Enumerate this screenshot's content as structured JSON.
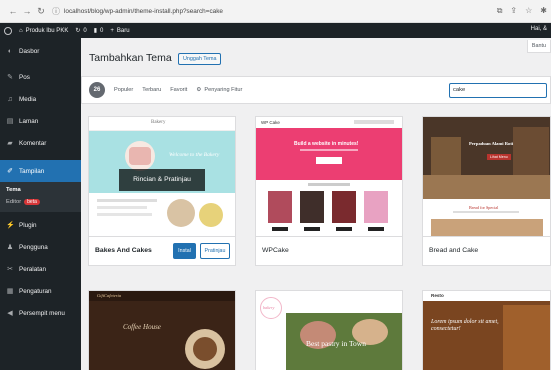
{
  "browser": {
    "back_icon": "arrow-left-icon",
    "forward_icon": "arrow-right-icon",
    "reload_icon": "reload-icon",
    "url": "localhost/blog/wp-admin/theme-install.php?search=cake"
  },
  "admin_bar": {
    "site_name": "Produk Ibu PKK",
    "comments_count": "0",
    "updates_count": "0",
    "new_label": "Baru",
    "greeting": "Hai, &"
  },
  "sidebar": {
    "items": [
      {
        "label": "Dasbor",
        "icon": "gauge-icon"
      },
      {
        "label": "Pos",
        "icon": "pin-icon"
      },
      {
        "label": "Media",
        "icon": "media-icon"
      },
      {
        "label": "Laman",
        "icon": "page-icon"
      },
      {
        "label": "Komentar",
        "icon": "comment-icon"
      },
      {
        "label": "Tampilan",
        "icon": "brush-icon"
      }
    ],
    "submenu": {
      "tema": "Tema",
      "editor": "Editor",
      "editor_badge": "beta"
    },
    "lower_items": [
      {
        "label": "Plugin",
        "icon": "plugin-icon"
      },
      {
        "label": "Pengguna",
        "icon": "user-icon"
      },
      {
        "label": "Peralatan",
        "icon": "wrench-icon"
      },
      {
        "label": "Pengaturan",
        "icon": "settings-icon"
      },
      {
        "label": "Persempit menu",
        "icon": "collapse-icon"
      }
    ]
  },
  "main": {
    "title": "Tambahkan Tema",
    "upload_button": "Unggah Tema",
    "help_tab": "Bantu",
    "filters": {
      "count": "26",
      "popular": "Populer",
      "latest": "Terbaru",
      "favorites": "Favorit",
      "feature_filter": "Penyaring Fitur"
    },
    "search_value": "cake"
  },
  "themes": [
    {
      "name": "Bakes And Cakes",
      "install": "Instal",
      "preview": "Pratinjau",
      "details": "Rincian & Pratinjau"
    },
    {
      "name": "WPCake"
    },
    {
      "name": "Bread and Cake"
    }
  ],
  "screenshots": {
    "s1_brand": "Bakery",
    "s1_tag": "Welcome to the Bakery",
    "s2_brand": "WP Cake",
    "s2_hero": "Build a website in minutes!",
    "s3_tag": "Perpaduan Alami Roti",
    "s3_btn": "Lihat Menu",
    "s3_caption": "Bread for Special",
    "s4_title": "Coffee House",
    "s4_brand": "GiftCafeteria",
    "s5_title": "Best pastry in Town",
    "s5_brand": "bakery",
    "s6_title": "Lorem ipsum dolor sit amet, consectetur!",
    "s6_brand": "Resto"
  }
}
